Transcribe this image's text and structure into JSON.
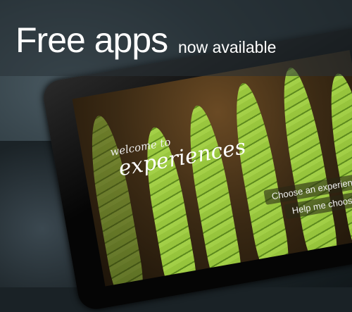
{
  "banner": {
    "title": "Free apps",
    "subtitle": "now available"
  },
  "app_screen": {
    "welcome": "welcome to",
    "app_name": "experiences",
    "buttons": [
      "Choose an experience",
      "Help me choose"
    ]
  },
  "colors": {
    "fern_green": "#8fc23a",
    "screen_brown": "#3b2a14",
    "text": "#ffffff"
  }
}
